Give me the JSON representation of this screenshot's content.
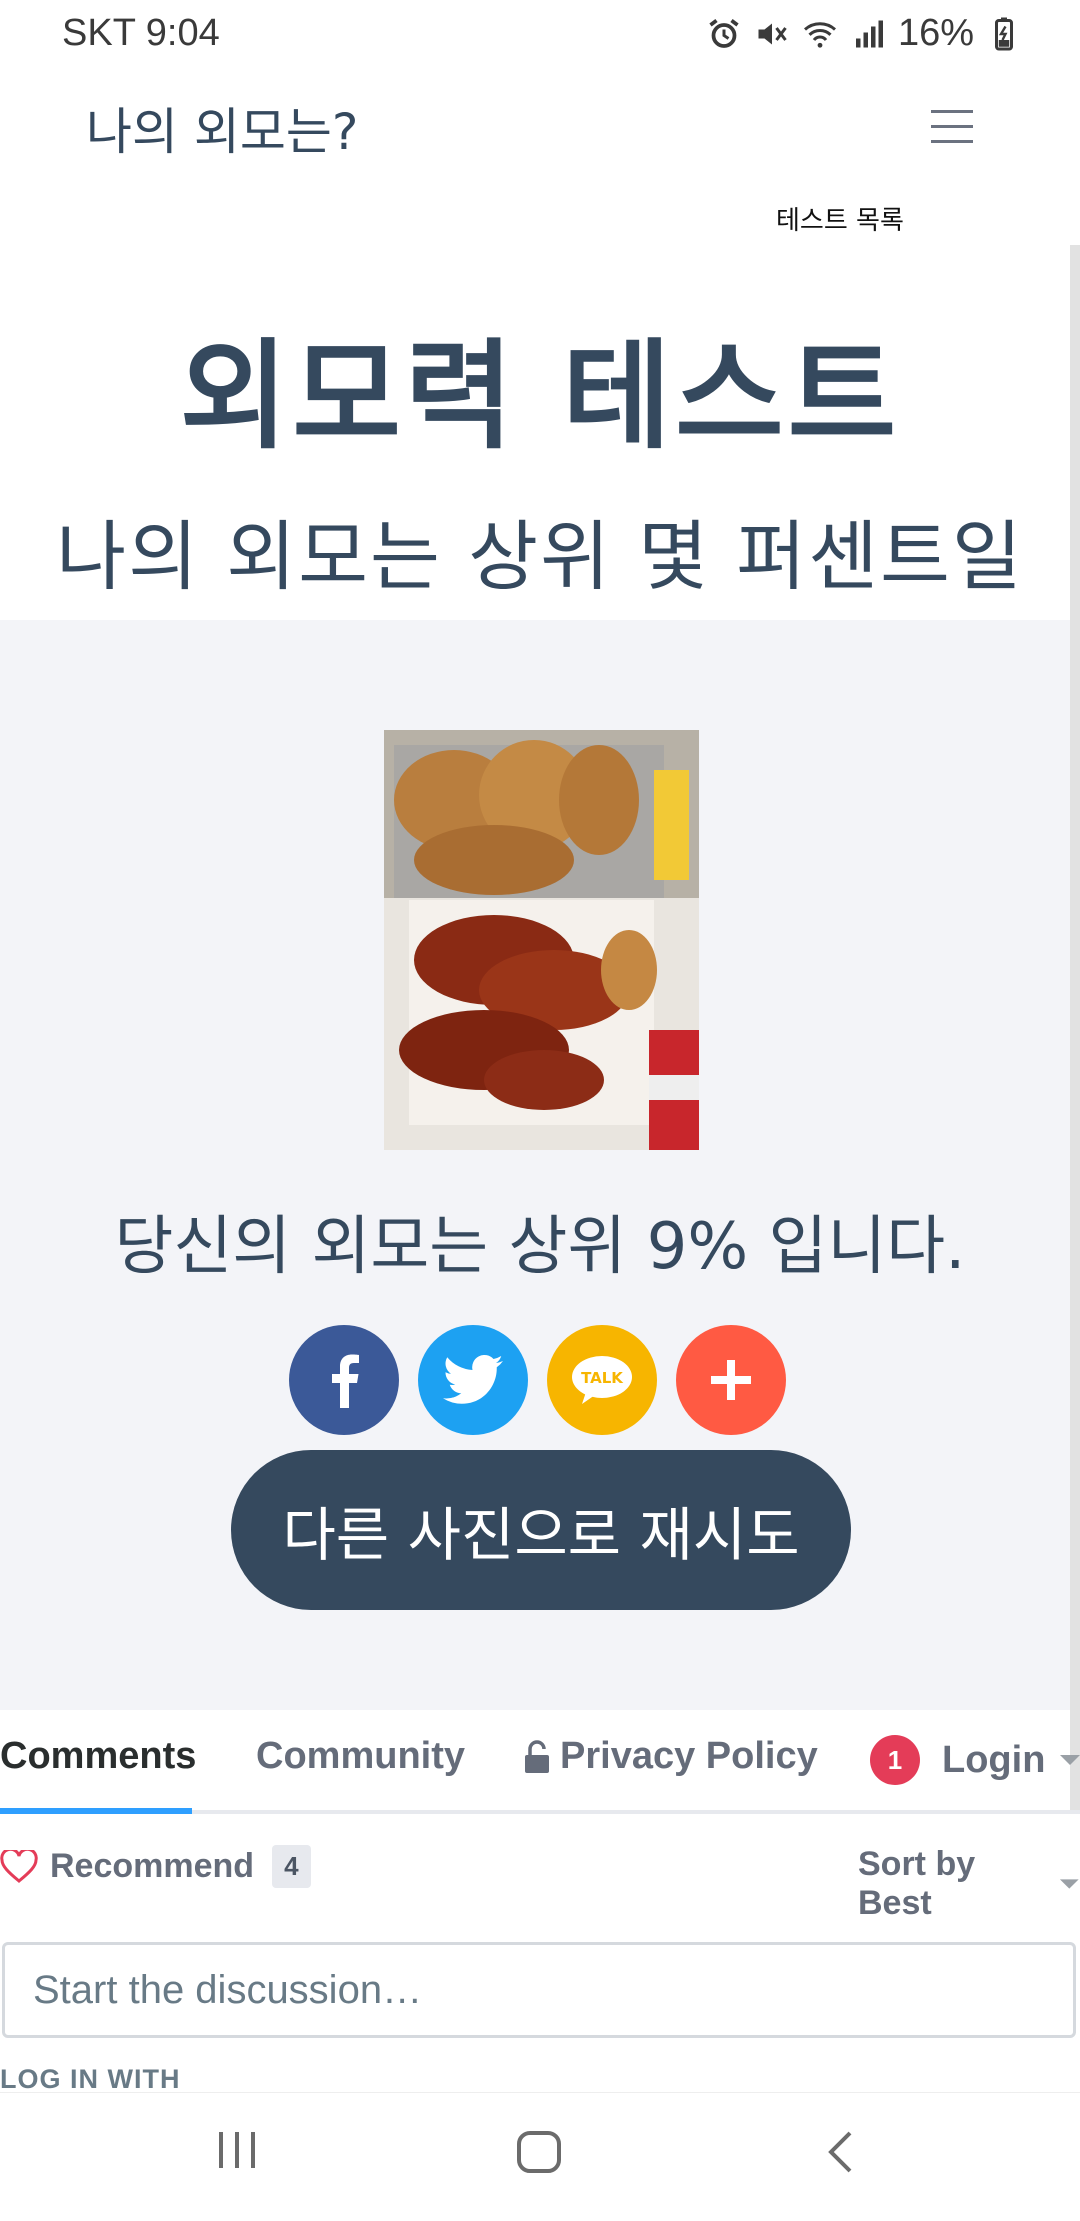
{
  "status_bar": {
    "carrier_time": "SKT 9:04",
    "battery": "16%"
  },
  "header": {
    "site_title": "나의 외모는?",
    "test_list_link": "테스트 목록"
  },
  "hero": {
    "title": "외모력 테스트",
    "subtitle": "나의 외모는 상위 몇 퍼센트일까?"
  },
  "result": {
    "text": "당신의 외모는 상위 9% 입니다.",
    "retry_label": "다른 사진으로 재시도"
  },
  "share": {
    "kakao_label": "TALK"
  },
  "comments": {
    "tabs": {
      "comments": "Comments",
      "community": "Community",
      "privacy": "Privacy Policy",
      "login": "Login"
    },
    "notification_count": "1",
    "recommend_label": "Recommend",
    "recommend_count": "4",
    "sort_label": "Sort by Best",
    "input_placeholder": "Start the discussion…",
    "login_with_label": "LOG IN WITH"
  },
  "colors": {
    "primary": "#35495e",
    "facebook": "#3b5998",
    "twitter": "#1da1f2",
    "kakao": "#f7b500",
    "more": "#ff5a43",
    "tab_active": "#2e9fff",
    "badge": "#e43c58"
  }
}
